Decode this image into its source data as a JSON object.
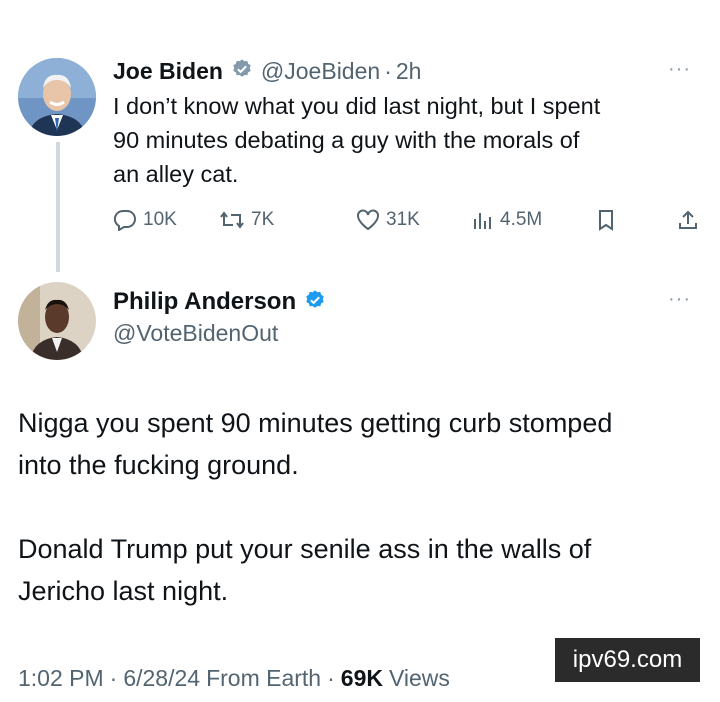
{
  "tweet1": {
    "name": "Joe Biden",
    "handle": "@JoeBiden",
    "separator": "·",
    "time": "2h",
    "more": "···",
    "text": "I don’t know what you did last night, but I spent 90 minutes debating a guy with the morals of an alley cat.",
    "text_lines": [
      "I don’t know what you did last night, but I spent",
      "90 minutes debating a guy with the morals of",
      "an alley cat."
    ],
    "replies": "10K",
    "reposts": "7K",
    "likes": "31K",
    "views": "4.5M"
  },
  "tweet2": {
    "name": "Philip Anderson",
    "handle": "@VoteBidenOut",
    "more": "···",
    "paragraphs": [
      [
        "Nigga you spent 90 minutes getting curb stomped",
        "into the fucking ground."
      ],
      [
        "Donald Trump put your senile ass in the walls of",
        "Jericho last night."
      ]
    ],
    "time": "1:02 PM",
    "date": "6/28/24",
    "source": "From Earth",
    "view_count": "69K",
    "views_label": "Views"
  },
  "watermark": "ipv69.com",
  "colors": {
    "verified_biden": "#829aab",
    "verified_blue": "#1d9bf0",
    "secondary_text": "#536471"
  }
}
